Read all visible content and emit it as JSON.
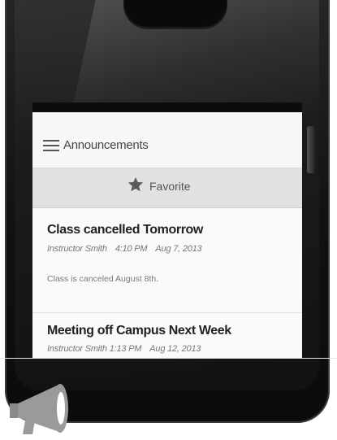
{
  "action_bar": {
    "title": "Announcements",
    "menu_icon": "hamburger-menu-icon"
  },
  "favorite": {
    "icon": "star-icon",
    "label": "Favorite"
  },
  "announcements": [
    {
      "title": "Class cancelled Tomorrow",
      "author": "Instructor Smith",
      "time": "4:10 PM",
      "date": "Aug 7, 2013",
      "body": "Class is canceled August 8th."
    },
    {
      "title": "Meeting off Campus Next Week",
      "author": "Instructor Smith",
      "time": "1:13 PM",
      "date": "Aug 12, 2013",
      "body": ""
    }
  ],
  "footer": {
    "icon": "megaphone-icon"
  },
  "colors": {
    "phone_body": "#111111",
    "screen_bg": "#f2f2f2",
    "favorite_bar": "#e1e1e1",
    "title_text": "#222222",
    "meta_text": "#777777",
    "megaphone": "#9a9a9a"
  }
}
